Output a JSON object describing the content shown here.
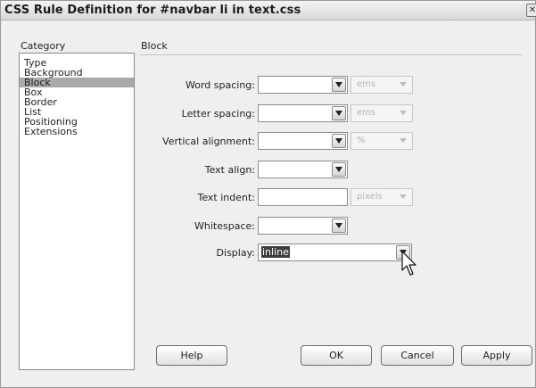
{
  "window": {
    "title": "CSS Rule Definition for #navbar li in text.css"
  },
  "category": {
    "header": "Category",
    "items": [
      "Type",
      "Background",
      "Block",
      "Box",
      "Border",
      "List",
      "Positioning",
      "Extensions"
    ],
    "selected": "Block"
  },
  "section": {
    "title": "Block"
  },
  "fields": {
    "word_spacing": {
      "label": "Word spacing:",
      "value": "",
      "unit": "ems"
    },
    "letter_spacing": {
      "label": "Letter spacing:",
      "value": "",
      "unit": "ems"
    },
    "vertical_alignment": {
      "label": "Vertical alignment:",
      "value": "",
      "unit": "%"
    },
    "text_align": {
      "label": "Text align:",
      "value": ""
    },
    "text_indent": {
      "label": "Text indent:",
      "value": "",
      "unit": "pixels"
    },
    "whitespace": {
      "label": "Whitespace:",
      "value": ""
    },
    "display": {
      "label": "Display:",
      "value": "inline"
    }
  },
  "buttons": {
    "help": "Help",
    "ok": "OK",
    "cancel": "Cancel",
    "apply": "Apply"
  },
  "icons": {
    "close": "close-icon",
    "dropdown": "chevron-down-icon",
    "cursor": "mouse-pointer-icon"
  }
}
